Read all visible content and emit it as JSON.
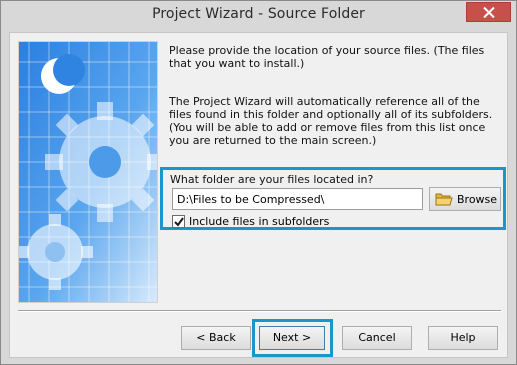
{
  "window": {
    "title": "Project Wizard - Source Folder"
  },
  "intro": {
    "paragraph1": "Please provide the location of your source files. (The files that you want to install.)",
    "paragraph2": "The Project Wizard will automatically reference all of the files found in this folder and optionally all of its subfolders. (You will be able to add or remove files from this list once you are returned to the main screen.)"
  },
  "folder": {
    "question": "What folder are your files located in?",
    "path_value": "D:\\Files to be Compressed\\",
    "browse_label": "Browse",
    "include_subfolders_label": "Include files in subfolders",
    "include_subfolders_checked": true
  },
  "buttons": {
    "back": "< Back",
    "next": "Next >",
    "cancel": "Cancel",
    "help": "Help"
  },
  "colors": {
    "highlight": "#1c95c9",
    "close_button": "#c7504a",
    "image_blue": "#3c8ee6"
  },
  "icons": {
    "close": "close-icon",
    "browse": "folder-icon",
    "check": "checkmark-icon",
    "side_image": "gear-graphic"
  }
}
